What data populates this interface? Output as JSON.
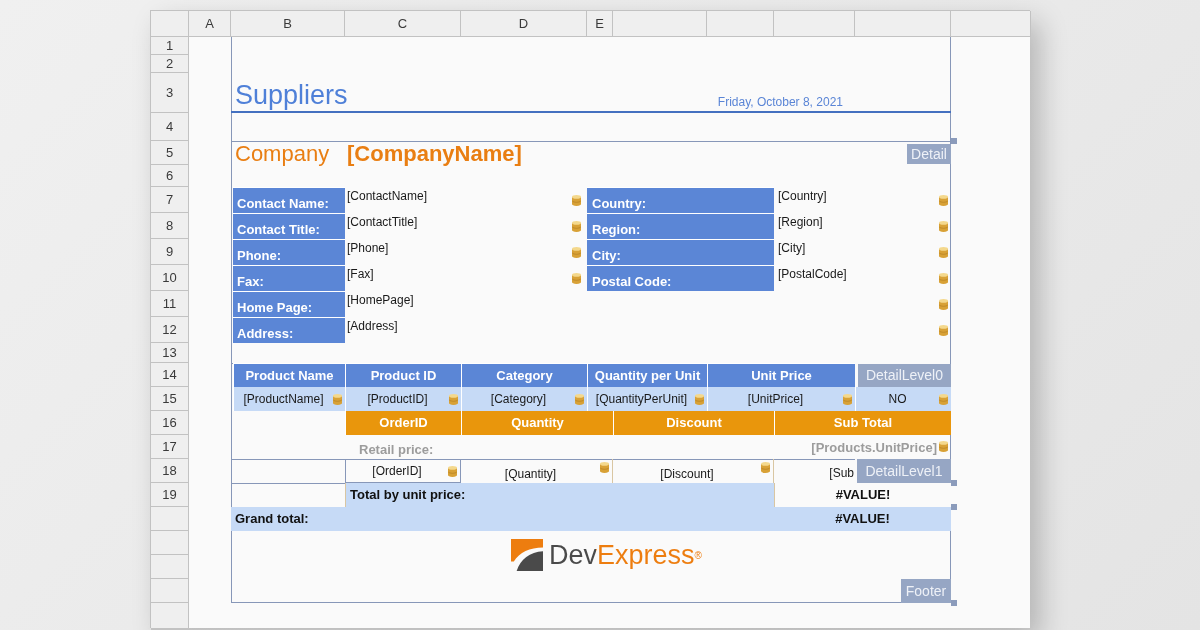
{
  "spreadsheet": {
    "column_headers": [
      "A",
      "B",
      "C",
      "D",
      "E"
    ],
    "row_headers": [
      "1",
      "2",
      "3",
      "4",
      "5",
      "6",
      "7",
      "8",
      "9",
      "10",
      "11",
      "12",
      "13",
      "14",
      "15",
      "16",
      "17",
      "18",
      "19"
    ]
  },
  "page_header": {
    "title": "Suppliers",
    "date": "Friday, October 8, 2021"
  },
  "detail": {
    "band_label": "Detail",
    "caption": "Company",
    "company_field": "[CompanyName]",
    "contact_fields": [
      {
        "label": "Contact Name:",
        "value": "[ContactName]"
      },
      {
        "label": "Contact Title:",
        "value": "[ContactTitle]"
      },
      {
        "label": "Phone:",
        "value": "[Phone]"
      },
      {
        "label": "Fax:",
        "value": "[Fax]"
      },
      {
        "label": "Home Page:",
        "value": "[HomePage]"
      },
      {
        "label": "Address:",
        "value": "[Address]"
      }
    ],
    "location_fields": [
      {
        "label": "Country:",
        "value": "[Country]"
      },
      {
        "label": "Region:",
        "value": "[Region]"
      },
      {
        "label": "City:",
        "value": "[City]"
      },
      {
        "label": "Postal Code:",
        "value": "[PostalCode]"
      }
    ]
  },
  "detail_level_0": {
    "band_label": "DetailLevel0",
    "columns": [
      {
        "header": "Product Name",
        "value": "[ProductName]"
      },
      {
        "header": "Product ID",
        "value": "[ProductID]"
      },
      {
        "header": "Category",
        "value": "[Category]"
      },
      {
        "header": "Quantity per Unit",
        "value": "[QuantityPerUnit]"
      },
      {
        "header": "Unit Price",
        "value": "[UnitPrice]"
      },
      {
        "value": "NO"
      }
    ]
  },
  "detail_level_1": {
    "band_label": "DetailLevel1",
    "headers": [
      "OrderID",
      "Quantity",
      "Discount",
      "Sub Total"
    ],
    "caption_row": [
      {
        "kind": "caption",
        "text": "Retail price:"
      },
      {
        "kind": "field",
        "text": "[Products.UnitPrice]"
      }
    ],
    "value_row": [
      {
        "kind": "boxed_field",
        "text": "[OrderID]"
      },
      {
        "kind": "field",
        "text": "[Quantity]"
      },
      {
        "kind": "field",
        "text": "[Discount]"
      },
      {
        "kind": "text",
        "text": "[Sub"
      }
    ]
  },
  "totals": [
    {
      "label": "Total by unit price:",
      "value": "#VALUE!"
    },
    {
      "label": "Grand total:",
      "value": "#VALUE!"
    }
  ],
  "footer": {
    "band_label": "Footer",
    "logo": {
      "wordmark": "DevExpress",
      "mark": "®"
    }
  }
}
